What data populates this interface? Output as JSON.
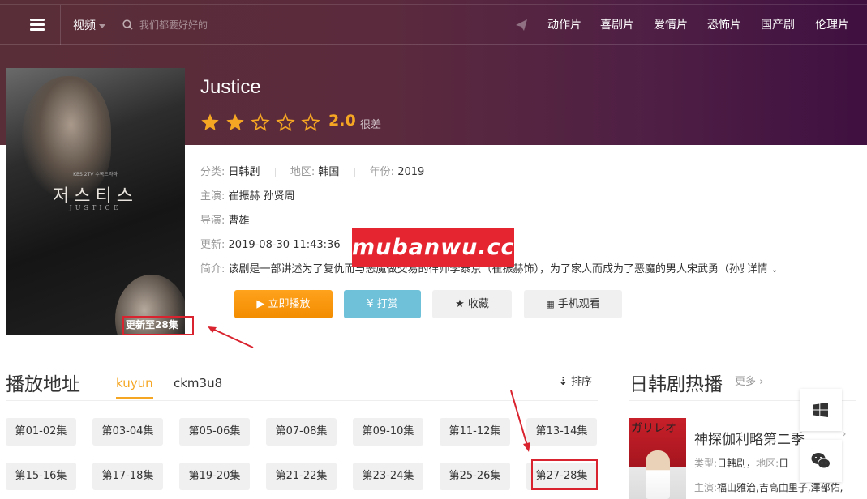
{
  "nav": {
    "channel": "视频",
    "search_placeholder": "我们都要好好的",
    "links": [
      "动作片",
      "喜剧片",
      "爱情片",
      "恐怖片",
      "国产剧",
      "伦理片"
    ]
  },
  "poster": {
    "korean_title": "저스티스",
    "english_title": "JUSTICE",
    "kbs_text": "KBS 2TV 수목드라마",
    "update_label": "更新至28集"
  },
  "detail": {
    "title": "Justice",
    "rating": {
      "score": "2.0",
      "label": "很差",
      "stars_filled": 2,
      "stars_total": 5
    },
    "category_label": "分类:",
    "category": "日韩剧",
    "region_label": "地区:",
    "region": "韩国",
    "year_label": "年份:",
    "year": "2019",
    "cast_label": "主演:",
    "cast": "崔振赫 孙贤周",
    "director_label": "导演:",
    "director": "曹雄",
    "updated_label": "更新:",
    "updated": "2019-08-30 11:43:36",
    "intro_label": "简介:",
    "intro": "该剧是一部讲述为了复仇而与恶魔做交易的律师李泰京（崔振赫饰），为了家人而成为了恶魔的男人宋武勇（孙贤",
    "more_label": "详情"
  },
  "watermark": "mubanwu.cc",
  "buttons": {
    "play": "▶ 立即播放",
    "tip": "¥ 打赏",
    "favorite": "★ 收藏",
    "mobile": "手机观看"
  },
  "play_section": {
    "title": "播放地址",
    "sources": [
      "kuyun",
      "ckm3u8"
    ],
    "sort_label": "排序",
    "episodes": [
      "第01-02集",
      "第03-04集",
      "第05-06集",
      "第07-08集",
      "第09-10集",
      "第11-12集",
      "第13-14集",
      "第15-16集",
      "第17-18集",
      "第19-20集",
      "第21-22集",
      "第23-24集",
      "第25-26集",
      "第27-28集"
    ]
  },
  "hot": {
    "title": "日韩剧热播",
    "more": "更多 ›",
    "item": {
      "poster_text": "ガリレオ",
      "name": "神探伽利略第二季",
      "type_label": "类型:",
      "type": "日韩剧，",
      "region_label": "地区:",
      "region": "日",
      "cast_label": "主演:",
      "cast": "福山雅治,吉高由里子,澤部佑,"
    }
  },
  "colors": {
    "accent": "#f5a623",
    "play_button": "#ff9900",
    "tip_button": "#6fc1da",
    "annotation": "#d9232e",
    "watermark_bg": "#e52630"
  }
}
